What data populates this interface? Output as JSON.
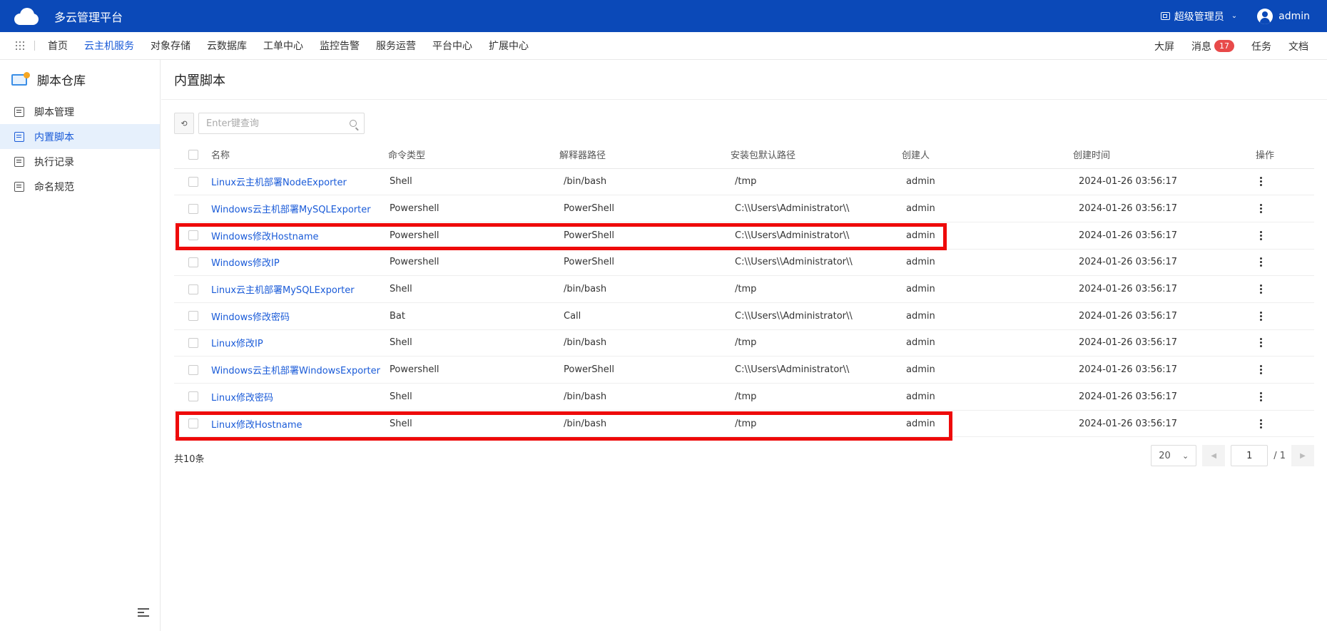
{
  "app": {
    "title": "多云管理平台"
  },
  "topbar": {
    "role": "超级管理员",
    "user": "admin"
  },
  "nav": {
    "items": [
      "首页",
      "云主机服务",
      "对象存储",
      "云数据库",
      "工单中心",
      "监控告警",
      "服务运营",
      "平台中心",
      "扩展中心"
    ],
    "active_index": 1,
    "right": {
      "screen": "大屏",
      "messages": "消息",
      "message_count": "17",
      "tasks": "任务",
      "docs": "文档"
    }
  },
  "sidebar": {
    "title": "脚本仓库",
    "items": [
      {
        "label": "脚本管理",
        "icon": "code-file-icon"
      },
      {
        "label": "内置脚本",
        "icon": "builtin-script-icon"
      },
      {
        "label": "执行记录",
        "icon": "record-icon"
      },
      {
        "label": "命名规范",
        "icon": "naming-icon"
      }
    ],
    "active_index": 1
  },
  "main": {
    "title": "内置脚本",
    "search": {
      "placeholder": "Enter键查询",
      "value": ""
    },
    "table": {
      "columns": [
        "名称",
        "命令类型",
        "解释器路径",
        "安装包默认路径",
        "创建人",
        "创建时间",
        "操作"
      ],
      "rows": [
        {
          "name": "Linux云主机部署NodeExporter",
          "type": "Shell",
          "interpreter": "/bin/bash",
          "path": "/tmp",
          "creator": "admin",
          "time": "2024-01-26 03:56:17"
        },
        {
          "name": "Windows云主机部署MySQLExporter",
          "type": "Powershell",
          "interpreter": "PowerShell",
          "path": "C:\\\\Users\\Administrator\\\\",
          "creator": "admin",
          "time": "2024-01-26 03:56:17"
        },
        {
          "name": "Windows修改Hostname",
          "type": "Powershell",
          "interpreter": "PowerShell",
          "path": "C:\\\\Users\\Administrator\\\\",
          "creator": "admin",
          "time": "2024-01-26 03:56:17"
        },
        {
          "name": "Windows修改IP",
          "type": "Powershell",
          "interpreter": "PowerShell",
          "path": "C:\\\\Users\\\\Administrator\\\\",
          "creator": "admin",
          "time": "2024-01-26 03:56:17"
        },
        {
          "name": "Linux云主机部署MySQLExporter",
          "type": "Shell",
          "interpreter": "/bin/bash",
          "path": "/tmp",
          "creator": "admin",
          "time": "2024-01-26 03:56:17"
        },
        {
          "name": "Windows修改密码",
          "type": "Bat",
          "interpreter": "Call",
          "path": "C:\\\\Users\\\\Administrator\\\\",
          "creator": "admin",
          "time": "2024-01-26 03:56:17"
        },
        {
          "name": "Linux修改IP",
          "type": "Shell",
          "interpreter": "/bin/bash",
          "path": "/tmp",
          "creator": "admin",
          "time": "2024-01-26 03:56:17"
        },
        {
          "name": "Windows云主机部署WindowsExporter",
          "type": "Powershell",
          "interpreter": "PowerShell",
          "path": "C:\\\\Users\\Administrator\\\\",
          "creator": "admin",
          "time": "2024-01-26 03:56:17"
        },
        {
          "name": "Linux修改密码",
          "type": "Shell",
          "interpreter": "/bin/bash",
          "path": "/tmp",
          "creator": "admin",
          "time": "2024-01-26 03:56:17"
        },
        {
          "name": "Linux修改Hostname",
          "type": "Shell",
          "interpreter": "/bin/bash",
          "path": "/tmp",
          "creator": "admin",
          "time": "2024-01-26 03:56:17"
        }
      ]
    },
    "footer": {
      "total": "共10条",
      "page_size": "20",
      "current_page": "1",
      "total_pages": "/ 1"
    }
  },
  "colors": {
    "topbar": "#0b49b8",
    "accent": "#1a5bd8",
    "highlight": "#ee0a0a",
    "badge": "#e84a4a"
  }
}
